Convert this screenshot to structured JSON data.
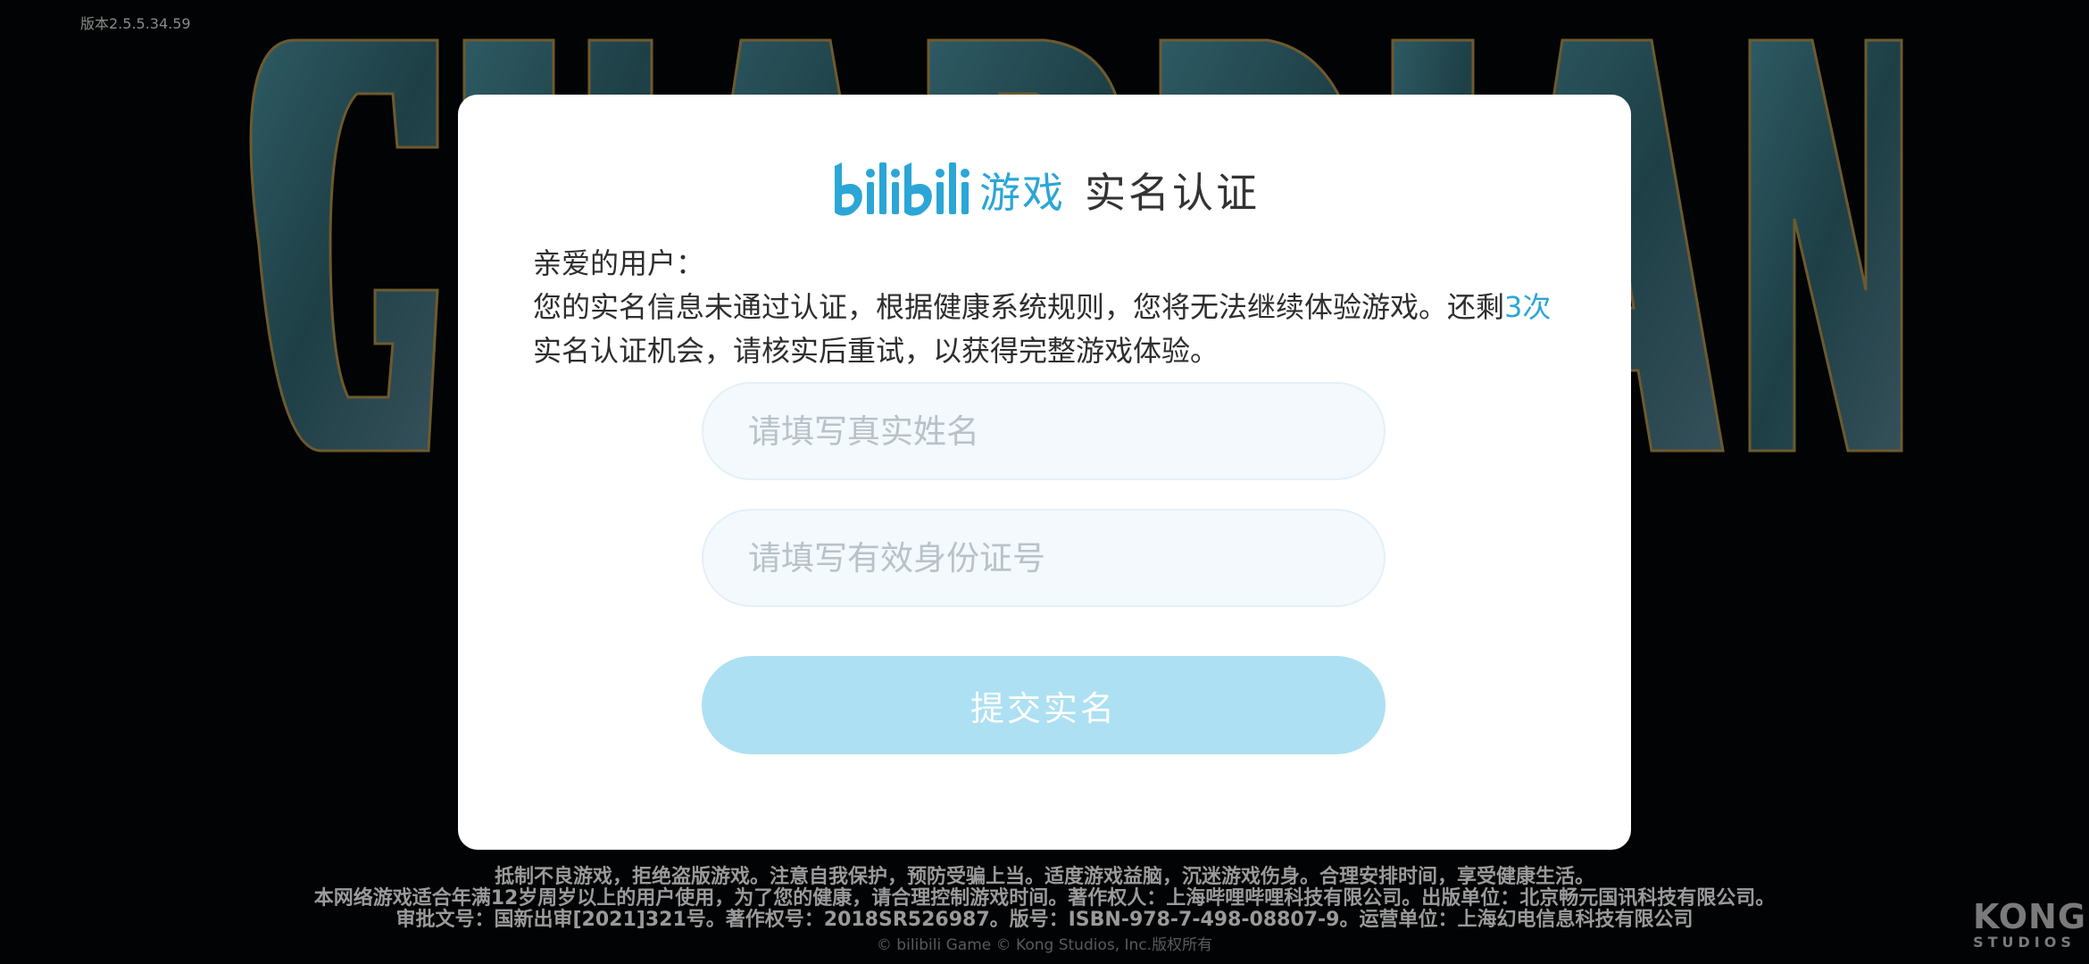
{
  "version_label": "版本2.5.5.34.59",
  "dialog": {
    "brand_game": "游戏",
    "title": "实名认证",
    "greeting": "亲爱的用户：",
    "message_before": "您的实名信息未通过认证，根据健康系统规则，您将无法继续体验游戏。还剩",
    "message_count": "3次",
    "message_after": "实名认证机会，请核实后重试，以获得完整游戏体验。",
    "name_field": {
      "placeholder": "请填写真实姓名",
      "value": ""
    },
    "id_field": {
      "placeholder": "请填写有效身份证号",
      "value": ""
    },
    "submit_label": "提交实名"
  },
  "footer": {
    "line1": "抵制不良游戏，拒绝盗版游戏。注意自我保护，预防受骗上当。适度游戏益脑，沉迷游戏伤身。合理安排时间，享受健康生活。",
    "line2": "本网络游戏适合年满12岁周岁以上的用户使用，为了您的健康，请合理控制游戏时间。著作权人：上海哔哩哔哩科技有限公司。出版单位：北京畅元国讯科技有限公司。",
    "line3": "审批文号：国新出审[2021]321号。著作权号：2018SR526987。版号：ISBN-978-7-498-08807-9。运营单位：上海幻电信息科技有限公司",
    "copyright": "© bilibili Game © Kong Studios, Inc.版权所有"
  },
  "studio_logo": {
    "line1": "KONG",
    "line2": "STUDIOS"
  },
  "colors": {
    "accent": "#2ba6d6",
    "submit_bg": "#ade0f2",
    "field_bg": "#f3f9fd",
    "background": "#020304"
  },
  "icons": {
    "brand": "bilibili-logo",
    "background_art": "guardian-tales-logo"
  }
}
